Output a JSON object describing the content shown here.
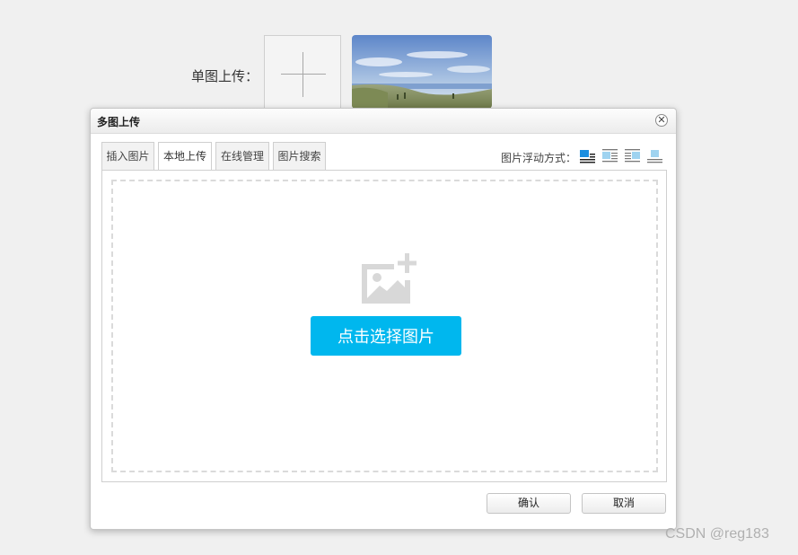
{
  "single_upload": {
    "label": "单图上传："
  },
  "dialog": {
    "title": "多图上传",
    "close_icon": "close-icon",
    "tabs": [
      {
        "label": "插入图片",
        "active": false
      },
      {
        "label": "本地上传",
        "active": true
      },
      {
        "label": "在线管理",
        "active": false
      },
      {
        "label": "图片搜索",
        "active": false
      }
    ],
    "float_label": "图片浮动方式：",
    "float_options": [
      "float-none-icon",
      "float-left-icon",
      "float-right-icon",
      "float-center-icon"
    ],
    "choose_button": "点击选择图片",
    "confirm": "确认",
    "cancel": "取消"
  },
  "colors": {
    "accent": "#00b7ee",
    "float_selected": "#1a8ee0"
  },
  "watermark": "CSDN @reg183"
}
